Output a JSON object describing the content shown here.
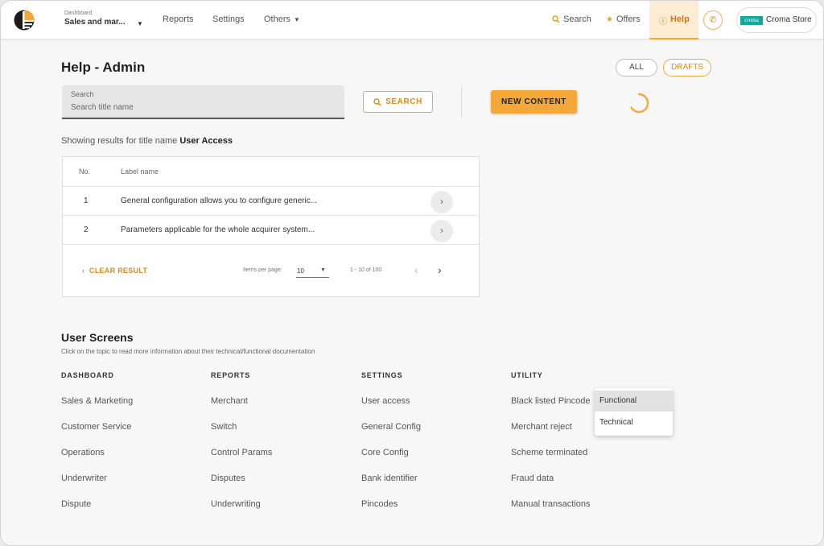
{
  "header": {
    "dashboard_small_label": "Dashboard",
    "dashboard_selected": "Sales and mar...",
    "nav": {
      "reports": "Reports",
      "settings": "Settings",
      "others": "Others"
    },
    "search": "Search",
    "offers": "Offers",
    "help": "Help",
    "store_logo_text": "croma",
    "store_name": "Croma Store",
    "accent_color": "#f5a83a"
  },
  "page": {
    "title": "Help - Admin",
    "filter_all": "ALL",
    "filter_drafts": "DRAFTS"
  },
  "search": {
    "label": "Search",
    "placeholder": "Search title name",
    "button": "SEARCH"
  },
  "new_content_button": "NEW CONTENT",
  "results": {
    "prefix": "Showing results for title name",
    "query": "User Access"
  },
  "table": {
    "columns": {
      "no": "No.",
      "label": "Label name"
    },
    "rows": [
      {
        "no": "1",
        "label": "General configuration allows you to configure generic..."
      },
      {
        "no": "2",
        "label": "Parameters applicable for the whole acquirer system..."
      }
    ],
    "clear_result": "CLEAR RESULT",
    "items_per_page_label": "Items per page:",
    "items_per_page_value": "10",
    "range": "1 - 10 of 100"
  },
  "user_screens": {
    "title": "User Screens",
    "subtitle": "Click on the topic to read more information about their technical/functional documentation",
    "columns": [
      {
        "heading": "DASHBOARD",
        "items": [
          "Sales & Marketing",
          "Customer Service",
          "Operations",
          "Underwriter",
          "Dispute"
        ]
      },
      {
        "heading": "REPORTS",
        "items": [
          "Merchant",
          "Switch",
          "Control Params",
          "Disputes",
          "Underwriting"
        ]
      },
      {
        "heading": "SETTINGS",
        "items": [
          "User access",
          "General Config",
          "Core Config",
          "Bank identifier",
          "Pincodes"
        ]
      },
      {
        "heading": "UTILITY",
        "items": [
          "Black listed Pincode",
          "Merchant reject",
          "Scheme terminated",
          "Fraud data",
          "Manual transactions"
        ]
      }
    ]
  },
  "dropdown": {
    "options": [
      "Functional",
      "Technical"
    ]
  }
}
